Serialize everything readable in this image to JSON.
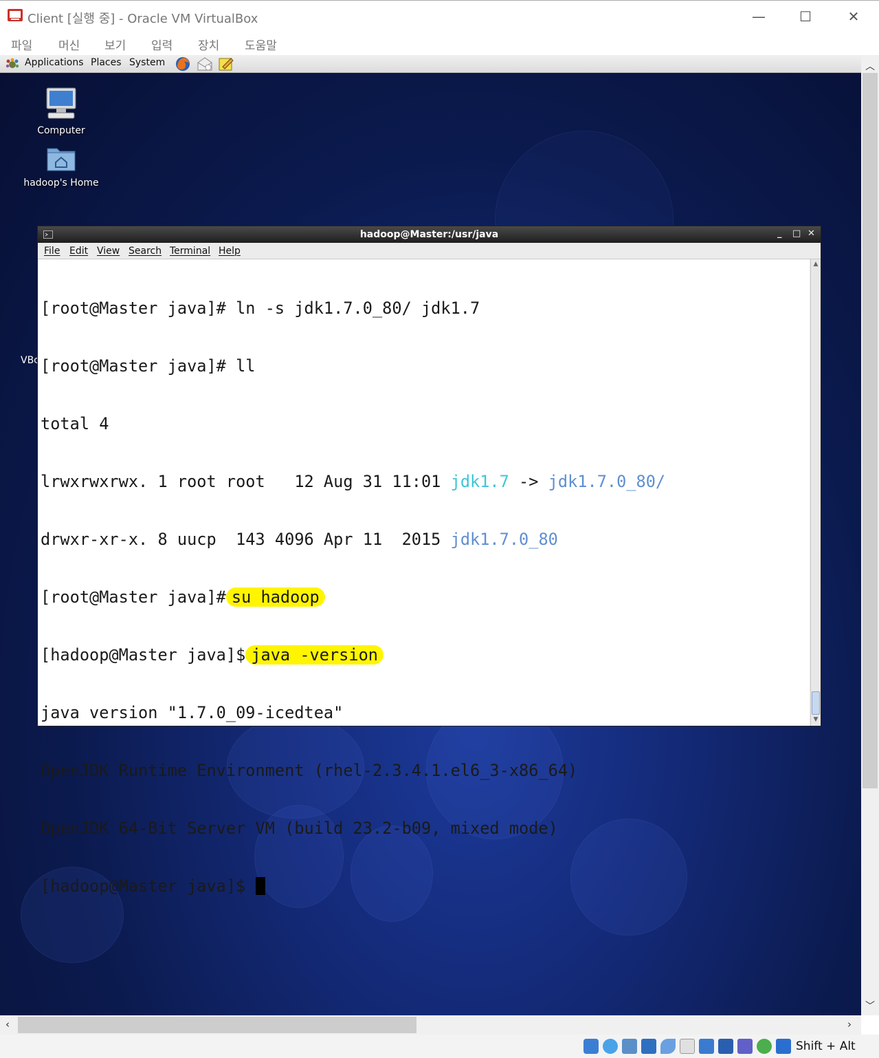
{
  "window": {
    "title": "Client [실행 중] - Oracle VM VirtualBox",
    "minimize": "—",
    "maximize": "☐",
    "close": "✕"
  },
  "vbox_menu": [
    "파일",
    "머신",
    "보기",
    "입력",
    "장치",
    "도움말"
  ],
  "gnome_panel": {
    "applications": "Applications",
    "places": "Places",
    "system": "System",
    "launchers": [
      "firefox-icon",
      "email-icon",
      "notes-icon"
    ]
  },
  "desktop": {
    "icons": [
      {
        "label": "Computer",
        "icon": "computer-icon"
      },
      {
        "label": "hadoop's Home",
        "icon": "home-folder-icon"
      }
    ],
    "partial_label": "VBc"
  },
  "terminal": {
    "title": "hadoop@Master:/usr/java",
    "menu": [
      "File",
      "Edit",
      "View",
      "Search",
      "Terminal",
      "Help"
    ],
    "lines": {
      "l1": "[root@Master java]# ln -s jdk1.7.0_80/ jdk1.7",
      "l2": "[root@Master java]# ll",
      "l3": "total 4",
      "l4_prefix": "lrwxrwxrwx. 1 root root   12 Aug 31 11:01 ",
      "l4_link": "jdk1.7",
      "l4_arrow": " -> ",
      "l4_target": "jdk1.7.0_80/",
      "l5_prefix": "drwxr-xr-x. 8 uucp  143 4096 Apr 11  2015 ",
      "l5_dir": "jdk1.7.0_80",
      "l6_prompt": "[root@Master java]#",
      "l6_cmd": "su hadoop",
      "l7_prompt": "[hadoop@Master java]$",
      "l7_cmd": "java -version",
      "l8": "java version \"1.7.0_09-icedtea\"",
      "l9": "OpenJDK Runtime Environment (rhel-2.3.4.1.el6_3-x86_64)",
      "l10": "OpenJDK 64-Bit Server VM (build 23.2-b09, mixed mode)",
      "l11_prompt": "[hadoop@Master java]$ "
    },
    "colors": {
      "symlink": "#3dc6d8",
      "directory": "#5f8fd0",
      "highlight": "#fff500"
    }
  },
  "statusbar": {
    "icons": [
      "hard-disk-icon",
      "optical-drive-icon",
      "audio-icon",
      "network-icon",
      "usb-icon",
      "shared-folder-icon",
      "display-icon",
      "video-capture-icon",
      "vt-x-icon",
      "mouse-integration-icon",
      "keyboard-capture-icon"
    ],
    "host_key": "Shift + Alt"
  }
}
